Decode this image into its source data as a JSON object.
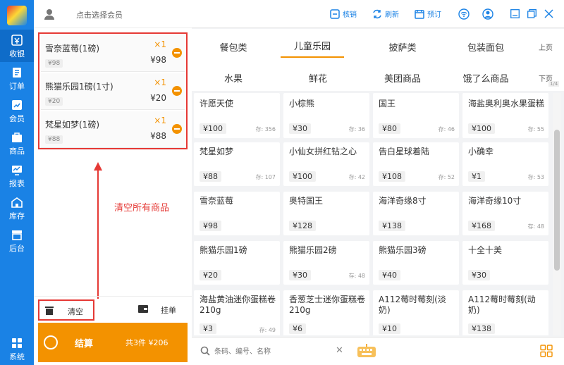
{
  "colors": {
    "nav_bg": "#1a82e5",
    "accent": "#f39200",
    "annotation": "#e53935"
  },
  "nav": {
    "items": [
      {
        "label": "收银",
        "icon": "cashier-icon",
        "active": true
      },
      {
        "label": "订单",
        "icon": "order-icon"
      },
      {
        "label": "会员",
        "icon": "member-icon"
      },
      {
        "label": "商品",
        "icon": "product-icon"
      },
      {
        "label": "报表",
        "icon": "report-icon"
      },
      {
        "label": "库存",
        "icon": "warehouse-icon"
      },
      {
        "label": "后台",
        "icon": "backend-icon"
      },
      {
        "label": "系统",
        "icon": "system-grid-icon"
      }
    ]
  },
  "member": {
    "placeholder": "点击选择会员"
  },
  "cart": {
    "items": [
      {
        "name": "雪奈蓝莓(1磅)",
        "unit_price": "¥98",
        "qty": "×1",
        "total": "¥98"
      },
      {
        "name": "熊猫乐园1磅(1寸)",
        "unit_price": "¥20",
        "qty": "×1",
        "total": "¥20"
      },
      {
        "name": "梵星如梦(1磅)",
        "unit_price": "¥88",
        "qty": "×1",
        "total": "¥88"
      }
    ],
    "annotation": "清空所有商品",
    "clear_label": "清空",
    "hang_label": "挂单",
    "checkout_label": "结算",
    "checkout_summary": "共3件 ¥206"
  },
  "topbar": {
    "items": [
      {
        "label": "核销",
        "icon": "verify-icon"
      },
      {
        "label": "刷新",
        "icon": "refresh-icon"
      },
      {
        "label": "预订",
        "icon": "calendar-icon"
      }
    ],
    "icons": [
      "wifi-icon",
      "user-icon",
      "minimize-icon",
      "restore-icon",
      "close-icon"
    ]
  },
  "categories": {
    "row1": [
      "餐包类",
      "儿童乐园",
      "披萨类",
      "包装面包"
    ],
    "row2": [
      "水果",
      "鲜花",
      "美团商品",
      "饿了么商品"
    ],
    "active": "儿童乐园",
    "prev_label": "上页",
    "next_label": "下页",
    "page_indicator": "1/4"
  },
  "products": [
    {
      "name": "许愿天使",
      "price": "¥100",
      "stock": "存: 356"
    },
    {
      "name": "小棕熊",
      "price": "¥30",
      "stock": "存: 36"
    },
    {
      "name": "国王",
      "price": "¥80",
      "stock": "存: 46"
    },
    {
      "name": "海盐奥利奥水果蛋糕",
      "price": "¥100",
      "stock": "存: 55"
    },
    {
      "name": "梵星如梦",
      "price": "¥88",
      "stock": "存: 107"
    },
    {
      "name": "小仙女拼红钻之心",
      "price": "¥100",
      "stock": "存: 42"
    },
    {
      "name": "告白星球着陆",
      "price": "¥108",
      "stock": "存: 52"
    },
    {
      "name": "小确幸",
      "price": "¥1",
      "stock": "存: 53"
    },
    {
      "name": "雪奈蓝莓",
      "price": "¥98",
      "stock": ""
    },
    {
      "name": "奥特国王",
      "price": "¥128",
      "stock": ""
    },
    {
      "name": "海洋奇缘8寸",
      "price": "¥138",
      "stock": ""
    },
    {
      "name": "海洋奇缘10寸",
      "price": "¥168",
      "stock": "存: 48"
    },
    {
      "name": "熊猫乐园1磅",
      "price": "¥20",
      "stock": ""
    },
    {
      "name": "熊猫乐园2磅",
      "price": "¥30",
      "stock": "存: 48"
    },
    {
      "name": "熊猫乐园3磅",
      "price": "¥40",
      "stock": ""
    },
    {
      "name": "十全十美",
      "price": "¥30",
      "stock": ""
    },
    {
      "name": "海盐黄油迷你蛋糕卷210g",
      "price": "¥3",
      "stock": "存: 49"
    },
    {
      "name": "香葱芝士迷你蛋糕卷210g",
      "price": "¥6",
      "stock": ""
    },
    {
      "name": "A112莓时莓刻(淡奶)",
      "price": "¥10",
      "stock": ""
    },
    {
      "name": "A112莓时莓刻(动奶)",
      "price": "¥138",
      "stock": ""
    }
  ],
  "search": {
    "placeholder": "条码、编号、名称"
  }
}
